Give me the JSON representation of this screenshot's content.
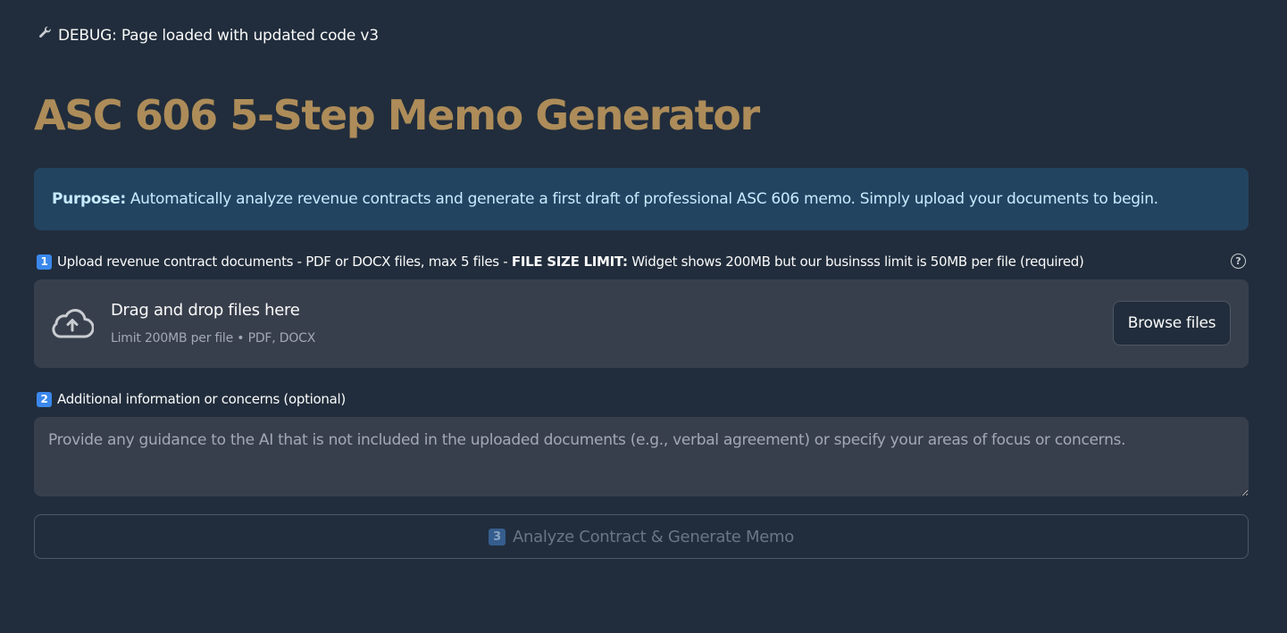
{
  "debug": {
    "icon": "wrench-icon",
    "text": "DEBUG: Page loaded with updated code v3"
  },
  "page_title": "ASC 606 5-Step Memo Generator",
  "purpose": {
    "label": "Purpose:",
    "text": "Automatically analyze revenue contracts and generate a first draft of professional ASC 606 memo. Simply upload your documents to begin."
  },
  "upload": {
    "step": "1",
    "label_prefix": "Upload revenue contract documents - PDF or DOCX files, max 5 files -",
    "label_bold": "FILE SIZE LIMIT:",
    "label_suffix": "Widget shows 200MB but our businsss limit is 50MB per file (required)",
    "help_icon": "?",
    "dropzone_title": "Drag and drop files here",
    "dropzone_subtitle": "Limit 200MB per file • PDF, DOCX",
    "browse_label": "Browse files"
  },
  "additional": {
    "step": "2",
    "label": "Additional information or concerns (optional)",
    "placeholder": "Provide any guidance to the AI that is not included in the uploaded documents (e.g., verbal agreement) or specify your areas of focus or concerns.",
    "value": ""
  },
  "analyze": {
    "step": "3",
    "label": "Analyze Contract & Generate Memo",
    "disabled": true
  },
  "colors": {
    "background": "#212d3c",
    "title": "#ad8c59",
    "info_bg": "#234461",
    "info_text": "#c7ebff",
    "panel_bg": "#383f4c",
    "step_badge": "#3b88ec"
  }
}
